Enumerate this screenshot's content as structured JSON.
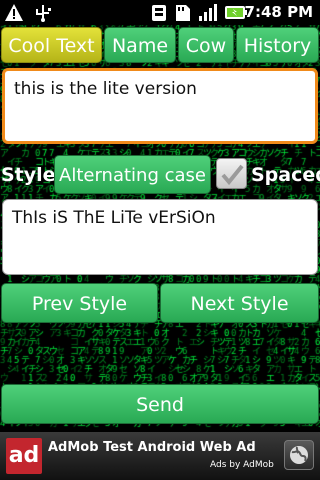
{
  "status_bar": {
    "icons": [
      "alert-icon",
      "usb-icon",
      "notification-icon",
      "sd-card-icon",
      "signal-icon",
      "battery-icon"
    ],
    "time": "7:48 PM"
  },
  "tabs": [
    {
      "label": "Cool Text",
      "active": true
    },
    {
      "label": "Name",
      "active": false
    },
    {
      "label": "Cow",
      "active": false
    },
    {
      "label": "History",
      "active": false
    }
  ],
  "input": {
    "value": "this is the lite version"
  },
  "style_row": {
    "label": "Style:",
    "selected": "Alternating case",
    "spaced_label": "Spaced",
    "spaced_checked": true
  },
  "output": {
    "value": "ThIs iS ThE LiTe vErSiOn"
  },
  "buttons": {
    "prev": "Prev Style",
    "next": "Next Style",
    "send": "Send"
  },
  "ad": {
    "logo_text": "ad",
    "title": "AdMob Test Android Web Ad",
    "byline": "Ads by AdMob"
  },
  "colors": {
    "button_green": "#3cbd68",
    "active_tab": "#d4d32b",
    "input_focus": "#f08a1a",
    "matrix_green": "#1fc34a"
  }
}
